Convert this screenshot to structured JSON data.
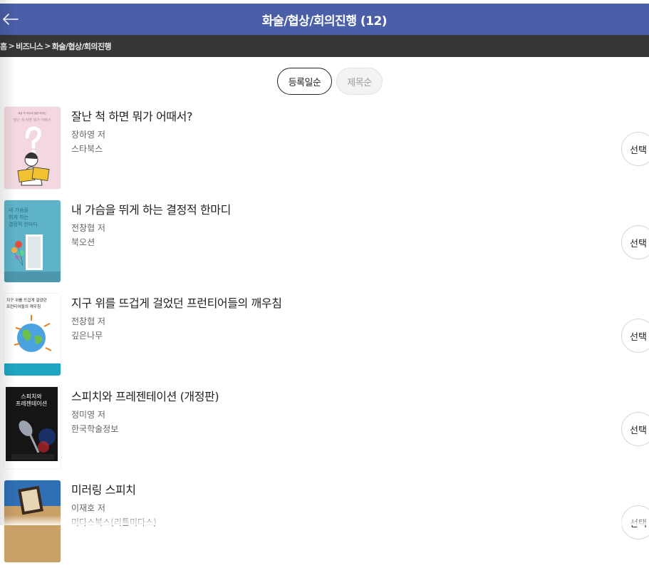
{
  "header": {
    "title": "화술/협상/회의진행 (12)",
    "back_icon": "arrow-left-icon"
  },
  "breadcrumb": {
    "items": [
      "홈",
      "비즈니스",
      "화술/협상/회의진행"
    ],
    "separator": ">"
  },
  "sort": {
    "options": [
      {
        "label": "등록일순",
        "active": true
      },
      {
        "label": "제목순",
        "active": false
      }
    ]
  },
  "books": [
    {
      "title": "잘난 척 하면 뭐가 어때서?",
      "author": "장하영 저",
      "publisher": "스타북스",
      "select_label": "선택"
    },
    {
      "title": "내 가슴을 뛰게 하는 결정적 한마디",
      "author": "전창협 저",
      "publisher": "북오션",
      "select_label": "선택"
    },
    {
      "title": "지구 위를 뜨겁게 걸었던 프런티어들의 깨우침",
      "author": "전창협 저",
      "publisher": "깊은나무",
      "select_label": "선택"
    },
    {
      "title": "스피치와 프레젠테이션 (개정판)",
      "author": "정미영 저",
      "publisher": "한국학술정보",
      "select_label": "선택"
    },
    {
      "title": "미러링 스피치",
      "author": "이재호 저",
      "publisher": "미다스북스(리틀미다스)",
      "select_label": "선택"
    }
  ],
  "covers": {
    "book1": {
      "line1": "잘난 척 하면 뭐가 어때서",
      "top_note": "세상 속 모두에 질문 하라는"
    },
    "book2": {
      "line1": "내 가슴을",
      "line2": "뛰게 하는",
      "line3": "결정적 한마디"
    },
    "book3": {
      "line1": "지구 위를 뜨겁게 걸었던",
      "line2": "프런티어들의 깨우침"
    },
    "book4": {
      "line1": "스피치와",
      "line2": "프레젠테이션"
    }
  },
  "colors": {
    "header_bg": "#4a5fa8",
    "breadcrumb_bg": "#363636"
  }
}
